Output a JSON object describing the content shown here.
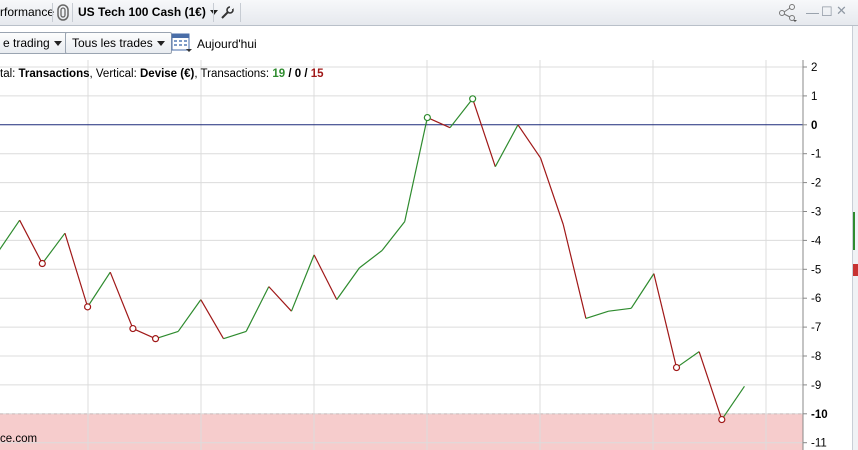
{
  "header": {
    "performance_label": "rformance",
    "instrument_label": "US Tech 100 Cash (1€)"
  },
  "toolbar": {
    "trading_dropdown": "e trading",
    "trades_dropdown": "Tous les trades",
    "today_label": "Aujourd'hui"
  },
  "legend": {
    "horizontal_prefix": "tal: ",
    "horizontal_value": "Transactions",
    "vertical_prefix": ", Vertical: ",
    "vertical_value": "Devise (€)",
    "transactions_prefix": ", Transactions: ",
    "wins": "19",
    "slash1": " / ",
    "even": "0",
    "slash2": " / ",
    "losses": "15"
  },
  "watermark": "ce.com",
  "colors": {
    "up": "#2e8b2e",
    "down": "#a01818",
    "zero_line": "#1c2a7a",
    "loss_zone": "#f6cccc",
    "grid": "#dcdcdc"
  },
  "chart_data": {
    "type": "line",
    "ylim": [
      -11,
      2
    ],
    "y_ticks": [
      2,
      1,
      0,
      -1,
      -2,
      -3,
      -4,
      -5,
      -6,
      -7,
      -8,
      -9,
      -10,
      -11
    ],
    "y_tick_labels": [
      "2",
      "1",
      "0",
      "-1",
      "-2",
      "-3",
      "-4",
      "-5",
      "-6",
      "-7",
      "-8",
      "-9",
      "-10",
      "-11"
    ],
    "bold_ticks": [
      0,
      -10
    ],
    "threshold": -10,
    "y": [
      -4.45,
      -3.3,
      -4.8,
      -3.75,
      -6.3,
      -5.1,
      -7.05,
      -7.4,
      -7.15,
      -6.05,
      -7.4,
      -7.15,
      -5.6,
      -6.45,
      -4.5,
      -6.05,
      -4.95,
      -4.35,
      -3.35,
      0.25,
      -0.1,
      0.9,
      -1.45,
      0.0,
      -1.15,
      -3.45,
      -6.7,
      -6.45,
      -6.35,
      -5.15,
      -8.4,
      -7.85,
      -10.2,
      -9.05
    ],
    "marked": [
      2,
      4,
      6,
      7,
      19,
      21,
      30,
      32
    ]
  }
}
